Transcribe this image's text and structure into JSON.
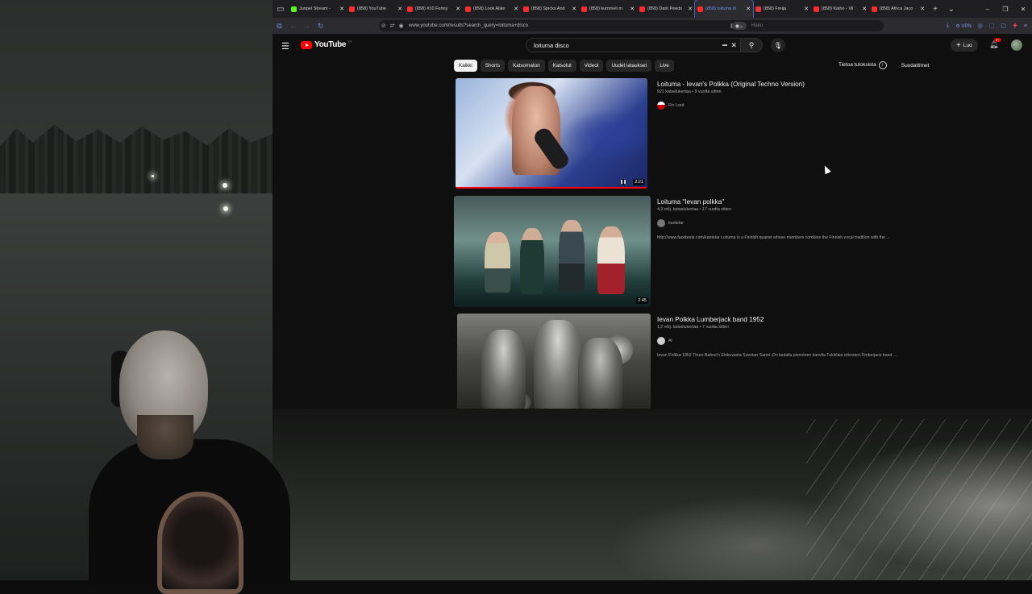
{
  "browser": {
    "tabs": [
      {
        "title": "Junpei Stream -",
        "icon": "kick-icon",
        "active": false
      },
      {
        "title": "(858) YouTube",
        "icon": "youtube-icon",
        "active": false
      },
      {
        "title": "(858) #10 Funny",
        "icon": "youtube-icon",
        "active": false
      },
      {
        "title": "(858) Look Alike",
        "icon": "youtube-icon",
        "active": false
      },
      {
        "title": "(858) Spicks And",
        "icon": "youtube-icon",
        "active": false
      },
      {
        "title": "(858) kummeli m",
        "icon": "youtube-icon",
        "active": false
      },
      {
        "title": "(858) Dark Peeds",
        "icon": "youtube-icon",
        "active": false
      },
      {
        "title": "(858) loituma di",
        "icon": "youtube-icon",
        "active": true
      },
      {
        "title": "(858) Freija",
        "icon": "globe-icon",
        "active": false
      },
      {
        "title": "(858) Kaiho - Vil",
        "icon": "youtube-icon",
        "active": false
      },
      {
        "title": "(858) Africa Jaco",
        "icon": "youtube-icon",
        "active": false
      }
    ],
    "url": "www.youtube.com/results?search_query=loituma+disco",
    "search_engine_placeholder": "Haku",
    "vpn_label": "VPN"
  },
  "youtube": {
    "logo_text": "YouTube",
    "logo_country": "FI",
    "search_query": "loituma disco",
    "create_label": "Luo",
    "notifications_badge": "9+",
    "chips": [
      "Kaikki",
      "Shorts",
      "Katsomaton",
      "Katsotut",
      "Videot",
      "Uudet lataukset",
      "Live"
    ],
    "active_chip": "Kaikki",
    "about_results_label": "Tietoa tuloksista",
    "filters_label": "Suodattimet"
  },
  "results": [
    {
      "title": "Loituma - Ievan's Polkka (Original Techno Version)",
      "stats": "921 katselukertaa • 9 vuotta sitten",
      "channel": "Fin Lord",
      "duration": "2.21",
      "description": ""
    },
    {
      "title": "Loituma \"Ievan polkka\"",
      "stats": "4,9 milj. katselukertaa • 17 vuotta sitten",
      "channel": "kantelar",
      "duration": "2.45",
      "description": "http://www.facebook.com/kantelar Loituma is a Finnish quartet whose members combine the Finnish vocal tradition with the ..."
    },
    {
      "title": "Ievan Polkka Lumberjack band 1952",
      "stats": "1,2 milj. katselukertaa • 7 vuotta sitten",
      "channel": "Al",
      "duration": "",
      "description": "Ievan Polkka 1952 Thure Bahne'n Elokuvasta Savotan Sanni ,On laulalla pienoinen kanvila Tukkilaia orkesteri,Timberjack band ..."
    }
  ],
  "colors": {
    "accent": "#ff0000",
    "active_tab": "#3d6bd1"
  }
}
